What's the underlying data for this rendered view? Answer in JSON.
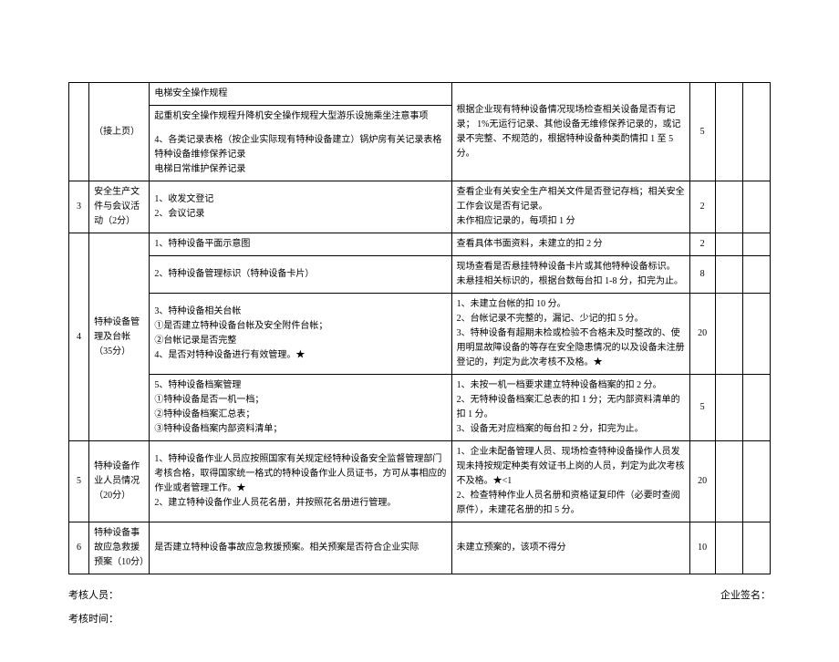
{
  "rows": {
    "r1_item": "电梯安全操作规程",
    "r2_cat": "（接上页）",
    "r2_item_a": "起重机安全操作规程升降机安全操作规程大型游乐设施乘坐注意事项",
    "r2_item_b": "4、各类记录表格（按企业实际现有特种设备建立）锅炉房有关记录表格\n特种设备维修保养记录\n电梯日常维护保养记录",
    "r2_crit": "根据企业现有特种设备情况现场检查相关设备是否有记录；\n1%无运行记录、其他设备无维修保养记录的，或记录不完整、不规范的，根据特种设备种类酌情扣 1 至 5 分。",
    "r2_score": "5",
    "r3_num": "3",
    "r3_cat": "安全生产文件与会议活动（2分）",
    "r3_item": "1、收发文登记\n2、会议记录",
    "r3_crit": "查看企业有关安全生产相关文件是否登记存档；相关安全工作会议是否有记录。\n未作相应记录的，每项扣 1 分",
    "r3_score": "2",
    "r4_num": "4",
    "r4_cat": "特种设备管理及台帐（35分）",
    "r4a_item": "1、特种设备平面示意图",
    "r4a_crit": "查看具体书面资料，未建立的扣 2 分",
    "r4a_score": "2",
    "r4b_item": "2、特种设备管理标识（特种设备卡片）",
    "r4b_crit": "现场查看是否悬挂特种设备卡片或其他特种设备标识。\n未悬挂相关标识的，根据台数每台扣 1-8 分，扣完为止。",
    "r4b_score": "8",
    "r4c_item": "3、特种设备相关台帐\n①是否建立特种设备台帐及安全附件台帐；\n②台帐记录是否完整\n4、是否对特种设备进行有效管理。★",
    "r4c_crit": "1、未建立台帐的扣 10 分。\n2、台帐记录不完整的，漏记、少记的扣 5 分。\n3、特种设备有超期未检或检验不合格未及时整改的、使用明显故障设备的等存在安全隐患情况的以及设备未注册登记的，判定为此次考核不及格。★",
    "r4c_score": "20",
    "r4d_item": "5、特种设备档案管理\n①特种设备是否一机一档；\n②特种设备档案汇总表；\n③特种设备档案内部资料清单；",
    "r4d_crit": "1、未按一机一档要求建立特种设备档案的扣 2 分。\n2、无特种设备档案汇总表的扣 1 分；无内部资料清单的扣 1 分。\n3、设备无对应档案的每台扣 2 分，扣完为止。",
    "r4d_score": "5",
    "r5_num": "5",
    "r5_cat": "特种设备作业人员情况（20分）",
    "r5_item": "1、特种设备作业人员应按照国家有关规定经特种设备安全监督管理部门考核合格，取得国家统一格式的特种设备作业人员证书，方可从事相应的作业或者管理工作。★\n2、建立特种设备作业人员花名册，并按照花名册进行管理。",
    "r5_crit": "1、企业未配备管理人员、现场检查特种设备操作人员发现未持按规定种类有效证书上岗的人员，判定为此次考核不及格。★<1\n2、检查特种作业人员名册和资格证复印件（必要时查阅原件），未建花名册的扣 5 分。",
    "r5_score": "20",
    "r6_num": "6",
    "r6_cat": "特种设备事故应急救援预案（10分）",
    "r6_item": "是否建立特种设备事故应急救援预案。相关预案是否符合企业实际",
    "r6_crit": "未建立预案的，该项不得分",
    "r6_score": "10"
  },
  "footer": {
    "assessor": "考核人员：",
    "sign": "企业签名：",
    "time": "考核时间："
  }
}
